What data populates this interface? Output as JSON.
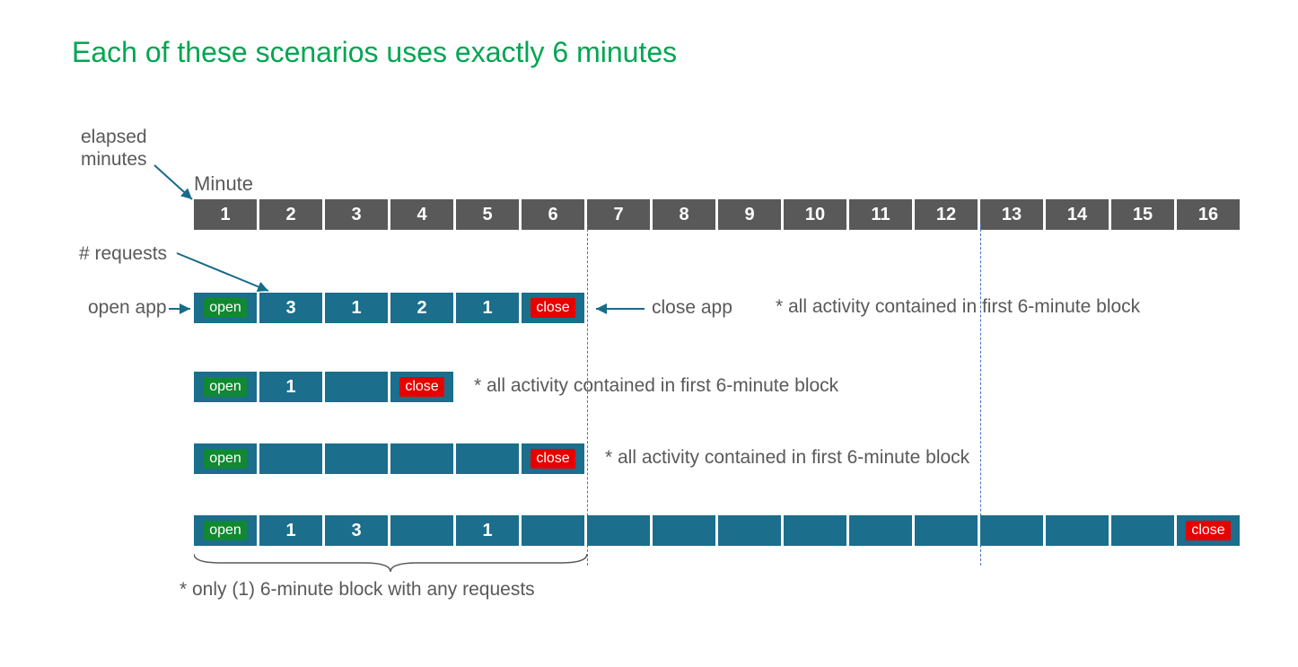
{
  "title": "Each of these scenarios uses exactly 6 minutes",
  "labels": {
    "elapsed": "elapsed\nminutes",
    "minute": "Minute",
    "requests": "# requests",
    "open_app": "open app",
    "close_app": "close app"
  },
  "badges": {
    "open": "open",
    "close": "close"
  },
  "minutes": [
    "1",
    "2",
    "3",
    "4",
    "5",
    "6",
    "7",
    "8",
    "9",
    "10",
    "11",
    "12",
    "13",
    "14",
    "15",
    "16"
  ],
  "scenarios": [
    {
      "cells": [
        "open",
        "3",
        "1",
        "2",
        "1",
        "close"
      ],
      "note": "* all activity contained in first 6-minute block"
    },
    {
      "cells": [
        "open",
        "1",
        "",
        "close"
      ],
      "note": "* all activity contained in first 6-minute block"
    },
    {
      "cells": [
        "open",
        "",
        "",
        "",
        "",
        "close"
      ],
      "note": "* all activity contained in first 6-minute block"
    },
    {
      "cells": [
        "open",
        "1",
        "3",
        "",
        "1",
        "",
        "",
        "",
        "",
        "",
        "",
        "",
        "",
        "",
        "",
        "close"
      ],
      "note": ""
    }
  ],
  "bottom_note": "* only (1) 6-minute block with any requests"
}
